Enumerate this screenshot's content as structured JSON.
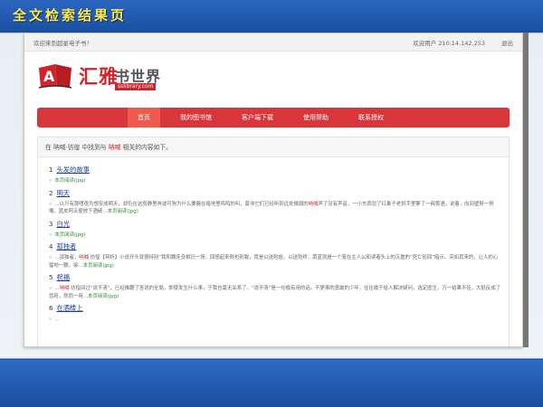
{
  "slide": {
    "title": "全文检索结果页"
  },
  "topbar": {
    "welcome": "欢迎来到超星电子书！",
    "user": "欢迎用户  210.14.142.253",
    "logout": "退出"
  },
  "logo": {
    "main": "汇雅",
    "right": "书世界",
    "sub": "sslibrary.com"
  },
  "nav": {
    "items": [
      "首页",
      "我的图书馆",
      "客户端下载",
      "使用帮助",
      "联系授权"
    ]
  },
  "info": {
    "prefix": "在 ",
    "scope": "呐喊·彷徨",
    "mid": " 中找到与 ",
    "keyword": "呐喊",
    "suffix": " 相关的内容如下。"
  },
  "results": [
    {
      "num": "1",
      "title": "头发的故事",
      "snip_a": "",
      "snip_mark": "",
      "snip_b": "",
      "read": "本页阅读(jpg)"
    },
    {
      "num": "2",
      "title": "明天",
      "snip_a": "…以只有那嗜夜为想安成明天，却仍在这寂静里奔波可狗为什么要躲在暗地里鸣鸣的叫，莫非它们已经听到远处微弱的",
      "snip_mark": "呐喊",
      "snip_b": "声了没有声音，一小东西忽了红鼻子老拱手里擎了一碗黄酒，说着，向间壁努一努嘴。蓝皮阿五便放下酒碗…",
      "read": "本页阅读(jpg)"
    },
    {
      "num": "3",
      "title": "白光",
      "snip_a": "",
      "snip_mark": "",
      "snip_b": "",
      "read": "本页阅读(jpg)"
    },
    {
      "num": "4",
      "title": "孤独者",
      "snip_a": "…孤独者，",
      "snip_mark": "呐喊",
      "snip_b": "·彷徨【冥析】小说开头就很特别“我和魏连殳相识一场，回想起来倒也别致，竟是以送殓始，以送殓终…菜蓝就是一个笼在主人公和读者头上的沉重的“死亡轮回”暗示。突如其来的，让人的心猛地一颤。接…",
      "read": "本页阅读(jpg)"
    },
    {
      "num": "5",
      "title": "祝福",
      "snip_a": "…",
      "snip_mark": "呐喊",
      "snip_b": "·彷徨间过“说不清”，已经推翻了答说的全局，即使发生什么事，于我也毫无关系了。“说不清”是一句极有用的话。不更事的勇敢的少年，往往敢于给人解决疑问，选定医生，万一结果不佳，大抵反成了怨府，然而一用…",
      "read": "本页阅读(jpg)"
    },
    {
      "num": "6",
      "title": "在酒楼上",
      "snip_a": "…",
      "snip_mark": "",
      "snip_b": "",
      "read": ""
    }
  ]
}
